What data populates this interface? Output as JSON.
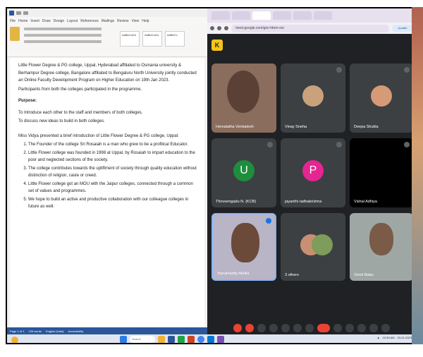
{
  "word": {
    "tabs": [
      "File",
      "Home",
      "Insert",
      "Draw",
      "Design",
      "Layout",
      "References",
      "Mailings",
      "Review",
      "View",
      "Help"
    ],
    "styles": [
      "AaBbCcDd",
      "AaBbCcDd",
      "AaBbCc"
    ],
    "paragraphs": [
      "Little Flower Degree & PG college, Uppal, Hyderabad affiliated to Osmania university & Berhampur Degree college, Bangalore affiliated to Bengaluru North University jointly conducted an Online Faculty Development Program on Higher Education on 19th Jan 2023.",
      "Participants from both the colleges participated in the programme."
    ],
    "heading": "Purpose:",
    "lines": [
      "To Introduce each other to the staff and members of both colleges.",
      "To discuss new ideas to build in both colleges."
    ],
    "intro": "Miss Vidya presented a brief introduction of Little Flower Degree & PG college, Uppal:",
    "list": [
      "The Founder of the college Sri Rosaiah is a man who grew to be a profilical Educator.",
      "Little Flower college was founded in 1998 at Uppal, by Rosaiah to impart education to the poor and neglected sections of the society.",
      "The college contributes towards the upliftment of society through quality education without distinction of religion, caste or creed.",
      "Little Flower college got an MOU with the Jaipur colleges, connected through a common set of values and programmes.",
      "We hope to build an active and productive collaboration with our colleague colleges in future as well."
    ],
    "status": [
      "Page 1 of 1",
      "226 words",
      "English (India)",
      "Accessibility"
    ]
  },
  "browser": {
    "url": "meet.google.com/gxv-hbrm-oxr",
    "profile_label": "Update"
  },
  "meet": {
    "logo": "K",
    "participants": [
      {
        "name": "Hemalatha Venkatesh",
        "kind": "video"
      },
      {
        "name": "Vinay Sneha",
        "kind": "photo"
      },
      {
        "name": "Deepa Shukla",
        "kind": "photo"
      },
      {
        "name": "Thiruvengadu N. (KCB)",
        "kind": "initial",
        "initial": "U",
        "color": "#1e8e3e"
      },
      {
        "name": "jayanthi radhakrishna",
        "kind": "initial",
        "initial": "P",
        "color": "#e52592"
      },
      {
        "name": "Vishal Adhiya",
        "kind": "dark"
      },
      {
        "name": "Yarramsetty Akhila",
        "kind": "video"
      },
      {
        "name": "3 others",
        "kind": "group"
      },
      {
        "name": "Vivek Babu",
        "kind": "video"
      }
    ],
    "controls": [
      "mic",
      "cam",
      "cc",
      "emoji",
      "present",
      "raise",
      "more",
      "hangup",
      "info",
      "people",
      "chat",
      "activities",
      "lock"
    ]
  },
  "taskbar": {
    "search": "Search",
    "time": "10:30 AM",
    "date": "20-01-2023"
  },
  "colors": {
    "word_blue": "#2b579a",
    "meet_bg": "#202124",
    "tile_bg": "#3c4043",
    "hangup_red": "#ea4335"
  }
}
